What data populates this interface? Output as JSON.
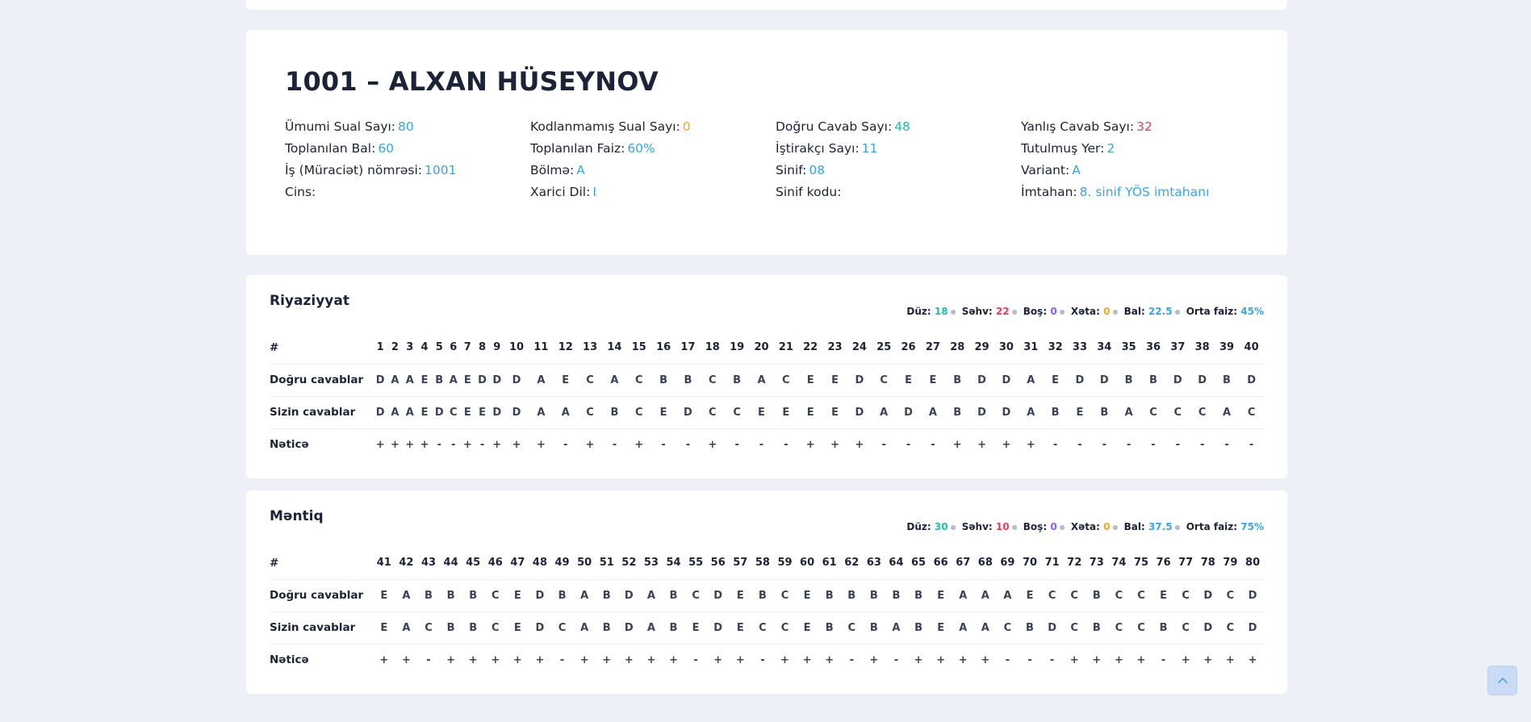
{
  "student": {
    "title": "1001 – ALXAN HÜSEYNOV",
    "info": [
      {
        "label": "Ümumi Sual Sayı:",
        "value": "80",
        "color": "#3aa4e8"
      },
      {
        "label": "Kodlanmamış Sual Sayı:",
        "value": "0",
        "color": "#f5a623"
      },
      {
        "label": "Doğru Cavab Sayı:",
        "value": "48",
        "color": "#1bbfb0"
      },
      {
        "label": "Yanlış Cavab Sayı:",
        "value": "32",
        "color": "#ee3b55"
      },
      {
        "label": "Toplanılan Bal:",
        "value": "60",
        "color": "#3aa4e8"
      },
      {
        "label": "Toplanılan Faiz:",
        "value": "60%",
        "color": "#3aa4e8"
      },
      {
        "label": "İştirakçı Sayı:",
        "value": "11",
        "color": "#3aa4e8"
      },
      {
        "label": "Tutulmuş Yer:",
        "value": "2",
        "color": "#3aa4e8"
      },
      {
        "label": "İş (Müraciət) nömrəsi:",
        "value": "1001",
        "color": "#3aa4e8"
      },
      {
        "label": "Bölmə:",
        "value": "A",
        "color": "#3aa4e8"
      },
      {
        "label": "Sinif:",
        "value": "08",
        "color": "#3aa4e8"
      },
      {
        "label": "Variant:",
        "value": "A",
        "color": "#3aa4e8"
      },
      {
        "label": "Cins:",
        "value": "",
        "color": "#3aa4e8"
      },
      {
        "label": "Xarici Dil:",
        "value": "I",
        "color": "#3aa4e8"
      },
      {
        "label": "Sinif kodu:",
        "value": "",
        "color": "#3aa4e8"
      },
      {
        "label": "İmtahan:",
        "value": "8. sinif YÖS imtahanı",
        "color": "#3aa4e8"
      }
    ]
  },
  "subjects": [
    {
      "title": "Riyaziyyat",
      "stats": {
        "duz_label": "Düz:",
        "duz": "18",
        "sehv_label": "Səhv:",
        "sehv": "22",
        "bos_label": "Boş:",
        "bos": "0",
        "xeta_label": "Xəta:",
        "xeta": "0",
        "bal_label": "Bal:",
        "bal": "22.5",
        "faiz_label": "Orta faiz:",
        "faiz": "45%"
      },
      "row_labels": {
        "num": "#",
        "correct": "Doğru cavablar",
        "yours": "Sizin cavablar",
        "result": "Nəticə"
      },
      "numbers": [
        "1",
        "2",
        "3",
        "4",
        "5",
        "6",
        "7",
        "8",
        "9",
        "10",
        "11",
        "12",
        "13",
        "14",
        "15",
        "16",
        "17",
        "18",
        "19",
        "20",
        "21",
        "22",
        "23",
        "24",
        "25",
        "26",
        "27",
        "28",
        "29",
        "30",
        "31",
        "32",
        "33",
        "34",
        "35",
        "36",
        "37",
        "38",
        "39",
        "40"
      ],
      "correct": [
        "D",
        "A",
        "A",
        "E",
        "B",
        "A",
        "E",
        "D",
        "D",
        "D",
        "A",
        "E",
        "C",
        "A",
        "C",
        "B",
        "B",
        "C",
        "B",
        "A",
        "C",
        "E",
        "E",
        "D",
        "C",
        "E",
        "E",
        "B",
        "D",
        "D",
        "A",
        "E",
        "D",
        "D",
        "B",
        "B",
        "D",
        "D",
        "B",
        "D"
      ],
      "yours": [
        "D",
        "A",
        "A",
        "E",
        "D",
        "C",
        "E",
        "E",
        "D",
        "D",
        "A",
        "A",
        "C",
        "B",
        "C",
        "E",
        "D",
        "C",
        "C",
        "E",
        "E",
        "E",
        "E",
        "D",
        "A",
        "D",
        "A",
        "B",
        "D",
        "D",
        "A",
        "B",
        "E",
        "B",
        "A",
        "C",
        "C",
        "C",
        "A",
        "C"
      ],
      "result": [
        "+",
        "+",
        "+",
        "+",
        "-",
        "-",
        "+",
        "-",
        "+",
        "+",
        "+",
        "-",
        "+",
        "-",
        "+",
        "-",
        "-",
        "+",
        "-",
        "-",
        "-",
        "+",
        "+",
        "+",
        "-",
        "-",
        "-",
        "+",
        "+",
        "+",
        "+",
        "-",
        "-",
        "-",
        "-",
        "-",
        "-",
        "-",
        "-",
        "-"
      ]
    },
    {
      "title": "Məntiq",
      "stats": {
        "duz_label": "Düz:",
        "duz": "30",
        "sehv_label": "Səhv:",
        "sehv": "10",
        "bos_label": "Boş:",
        "bos": "0",
        "xeta_label": "Xəta:",
        "xeta": "0",
        "bal_label": "Bal:",
        "bal": "37.5",
        "faiz_label": "Orta faiz:",
        "faiz": "75%"
      },
      "row_labels": {
        "num": "#",
        "correct": "Doğru cavablar",
        "yours": "Sizin cavablar",
        "result": "Nəticə"
      },
      "numbers": [
        "41",
        "42",
        "43",
        "44",
        "45",
        "46",
        "47",
        "48",
        "49",
        "50",
        "51",
        "52",
        "53",
        "54",
        "55",
        "56",
        "57",
        "58",
        "59",
        "60",
        "61",
        "62",
        "63",
        "64",
        "65",
        "66",
        "67",
        "68",
        "69",
        "70",
        "71",
        "72",
        "73",
        "74",
        "75",
        "76",
        "77",
        "78",
        "79",
        "80"
      ],
      "correct": [
        "E",
        "A",
        "B",
        "B",
        "B",
        "C",
        "E",
        "D",
        "B",
        "A",
        "B",
        "D",
        "A",
        "B",
        "C",
        "D",
        "E",
        "B",
        "C",
        "E",
        "B",
        "B",
        "B",
        "B",
        "B",
        "E",
        "A",
        "A",
        "A",
        "E",
        "C",
        "C",
        "B",
        "C",
        "C",
        "E",
        "C",
        "D",
        "C",
        "D"
      ],
      "yours": [
        "E",
        "A",
        "C",
        "B",
        "B",
        "C",
        "E",
        "D",
        "C",
        "A",
        "B",
        "D",
        "A",
        "B",
        "E",
        "D",
        "E",
        "C",
        "C",
        "E",
        "B",
        "C",
        "B",
        "A",
        "B",
        "E",
        "A",
        "A",
        "C",
        "B",
        "D",
        "C",
        "B",
        "C",
        "C",
        "B",
        "C",
        "D",
        "C",
        "D"
      ],
      "result": [
        "+",
        "+",
        "-",
        "+",
        "+",
        "+",
        "+",
        "+",
        "-",
        "+",
        "+",
        "+",
        "+",
        "+",
        "-",
        "+",
        "+",
        "-",
        "+",
        "+",
        "+",
        "-",
        "+",
        "-",
        "+",
        "+",
        "+",
        "+",
        "-",
        "-",
        "-",
        "+",
        "+",
        "+",
        "+",
        "-",
        "+",
        "+",
        "+",
        "+"
      ]
    }
  ],
  "scroll_top": {
    "icon": "arrow-up-icon"
  },
  "colors": {
    "accent": "#3aa4e8",
    "plus": "#1fc1a5",
    "minus": "#f36b7f",
    "background": "#eef0f8"
  }
}
